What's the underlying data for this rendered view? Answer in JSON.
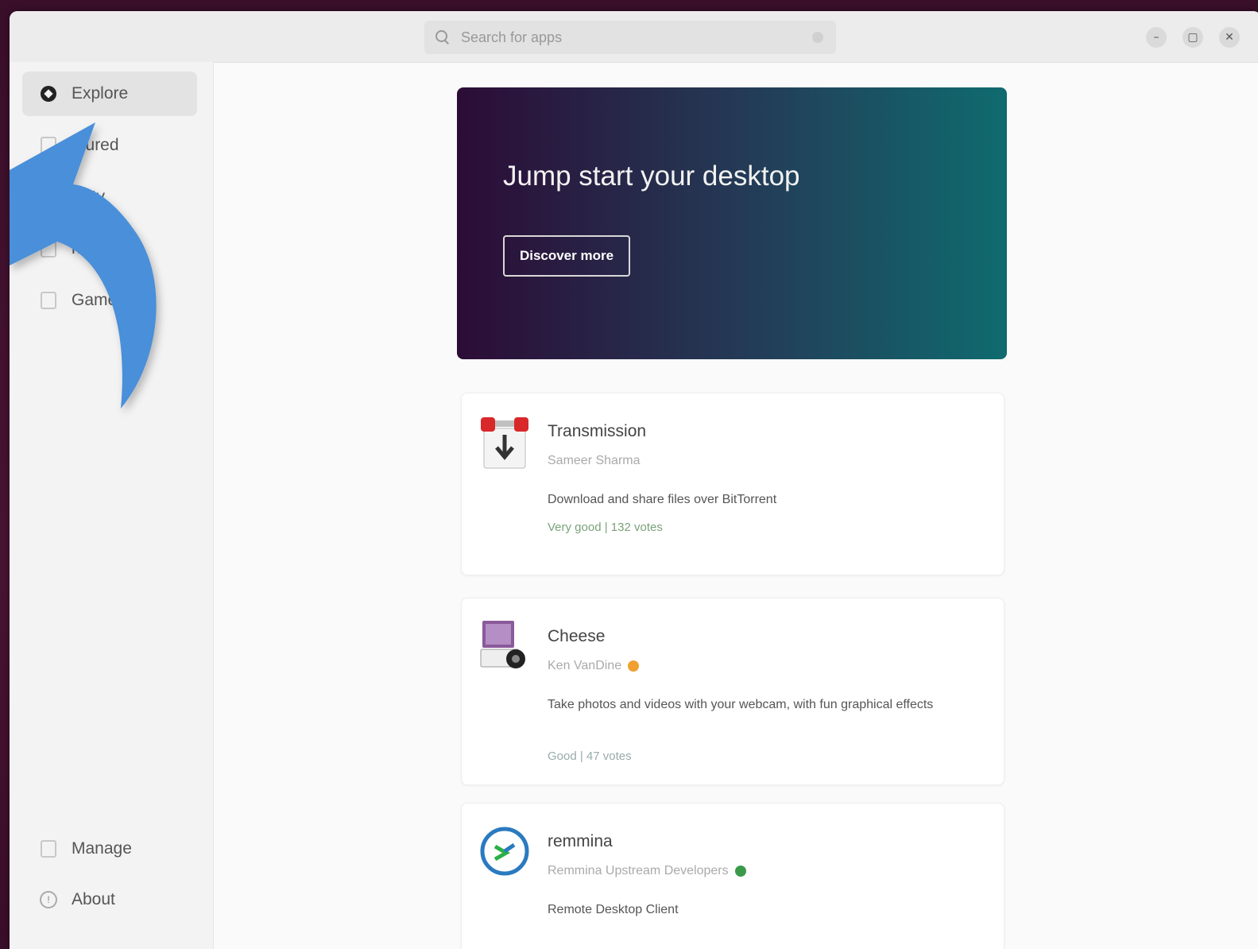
{
  "header": {
    "search_placeholder": "Search for apps",
    "controls": {
      "minimize": "–",
      "maximize": "▢",
      "close": "✕"
    }
  },
  "sidebar": {
    "items": [
      {
        "label": "Explore",
        "icon": "explore-icon"
      },
      {
        "label": "atured",
        "icon": "featured-icon"
      },
      {
        "label": "tivity",
        "icon": "productivity-icon"
      },
      {
        "label": "nt",
        "icon": "development-icon"
      },
      {
        "label": "Game",
        "icon": "games-icon"
      }
    ],
    "bottom": [
      {
        "label": "Manage",
        "icon": "manage-icon"
      },
      {
        "label": "About",
        "icon": "about-icon"
      }
    ]
  },
  "hero": {
    "title": "Jump start your desktop",
    "button": "Discover more"
  },
  "apps": [
    {
      "name": "Transmission",
      "developer": "Sameer Sharma",
      "description": "Download and share files over BitTorrent",
      "rating": "Very good | 132 votes",
      "icon": "transmission-icon"
    },
    {
      "name": "Cheese",
      "developer": "Ken VanDine",
      "description": "Take photos and videos with your webcam, with fun graphical effects",
      "rating": "Good | 47 votes",
      "icon": "cheese-icon",
      "badge_color": "#f0a030"
    },
    {
      "name": "remmina",
      "developer": "Remmina Upstream Developers",
      "description": "Remote Desktop Client",
      "icon": "remmina-icon",
      "badge_color": "#3a9a4a"
    }
  ],
  "colors": {
    "accent_arrow": "#4a8fd9",
    "hero_start": "#2c0c36",
    "hero_end": "#0f6b6f"
  }
}
